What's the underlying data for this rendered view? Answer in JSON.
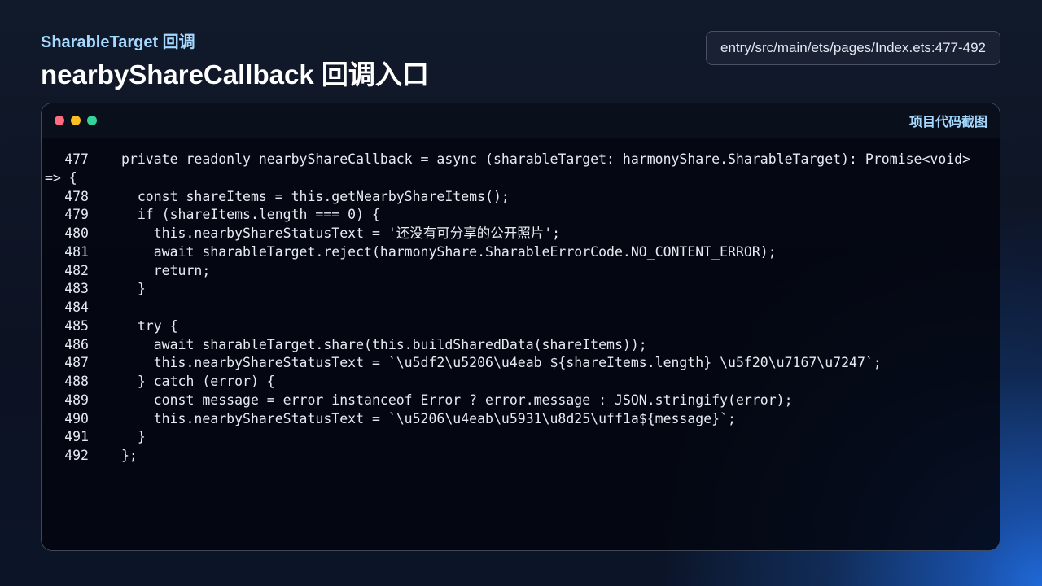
{
  "header": {
    "kicker": "SharableTarget 回调",
    "title": "nearbyShareCallback 回调入口",
    "source_path": "entry/src/main/ets/pages/Index.ets:477-492"
  },
  "code_window": {
    "label": "项目代码截图",
    "lines": [
      {
        "number": "477",
        "text": "private readonly nearbyShareCallback = async (sharableTarget: harmonyShare.SharableTarget): Promise<void> => {"
      },
      {
        "number": "478",
        "text": "  const shareItems = this.getNearbyShareItems();"
      },
      {
        "number": "479",
        "text": "  if (shareItems.length === 0) {"
      },
      {
        "number": "480",
        "text": "    this.nearbyShareStatusText = '还没有可分享的公开照片';"
      },
      {
        "number": "481",
        "text": "    await sharableTarget.reject(harmonyShare.SharableErrorCode.NO_CONTENT_ERROR);"
      },
      {
        "number": "482",
        "text": "    return;"
      },
      {
        "number": "483",
        "text": "  }"
      },
      {
        "number": "484",
        "text": ""
      },
      {
        "number": "485",
        "text": "  try {"
      },
      {
        "number": "486",
        "text": "    await sharableTarget.share(this.buildSharedData(shareItems));"
      },
      {
        "number": "487",
        "text": "    this.nearbyShareStatusText = `\\u5df2\\u5206\\u4eab ${shareItems.length} \\u5f20\\u7167\\u7247`;"
      },
      {
        "number": "488",
        "text": "  } catch (error) {"
      },
      {
        "number": "489",
        "text": "    const message = error instanceof Error ? error.message : JSON.stringify(error);"
      },
      {
        "number": "490",
        "text": "    this.nearbyShareStatusText = `\\u5206\\u4eab\\u5931\\u8d25\\uff1a${message}`;"
      },
      {
        "number": "491",
        "text": "  }"
      },
      {
        "number": "492",
        "text": "};"
      }
    ]
  },
  "theme": {
    "accent": "#a5d8ff",
    "window_dots": [
      "#ff6b81",
      "#fbbf24",
      "#34d399"
    ]
  }
}
